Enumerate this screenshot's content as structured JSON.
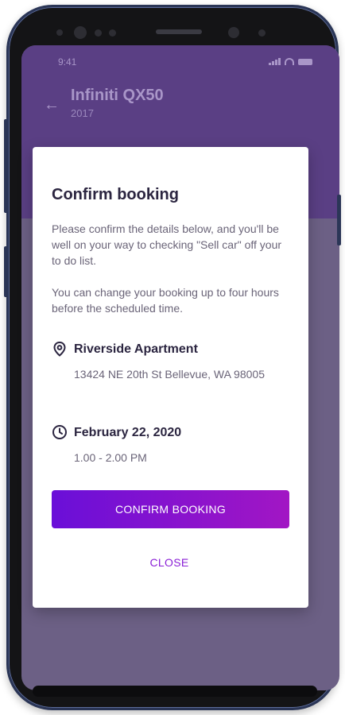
{
  "status_bar": {
    "time": "9:41"
  },
  "header": {
    "title": "Infiniti QX50",
    "subtitle": "2017"
  },
  "modal": {
    "title": "Confirm booking",
    "paragraph1": "Please confirm the details below, and you'll be well on your way to checking \"Sell car\" off your to do list.",
    "paragraph2": "You can change your booking up to four hours before the scheduled time.",
    "location": {
      "icon": "location-pin-icon",
      "name": "Riverside Apartment",
      "address": "13424 NE 20th St Bellevue, WA 98005"
    },
    "schedule": {
      "icon": "clock-icon",
      "date": "February 22, 2020",
      "time": "1.00 - 2.00 PM"
    },
    "confirm_label": "CONFIRM BOOKING",
    "close_label": "CLOSE"
  },
  "colors": {
    "header_bg": "#5a3f84",
    "overlay_bg": "#6c6085",
    "button_gradient_start": "#6a0fd8",
    "button_gradient_end": "#a216c4",
    "close_text": "#8a1fd6",
    "title_text": "#2b2540",
    "body_text": "#6a6478"
  }
}
